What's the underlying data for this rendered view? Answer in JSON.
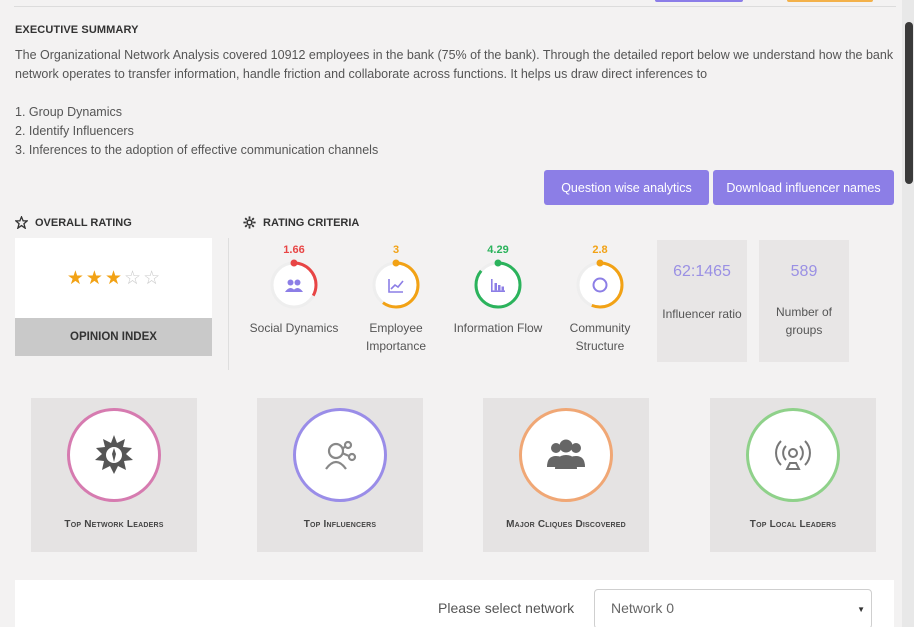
{
  "executive_summary": {
    "title": "EXECUTIVE SUMMARY",
    "text": "The Organizational Network Analysis covered 10912 employees in the bank (75% of the bank). Through the detailed report below we understand how the bank network operates to transfer information, handle friction and collaborate across functions. It helps us draw direct inferences to",
    "items": [
      "1. Group Dynamics",
      "2. Identify Influencers",
      "3. Inferences to the adoption of effective communication channels"
    ]
  },
  "actions": {
    "question_wise": "Question wise analytics",
    "download_influencers": "Download influencer names"
  },
  "overall_rating": {
    "title": "OVERALL RATING",
    "stars_filled": 3,
    "stars_total": 5,
    "opinion_index_label": "OPINION INDEX"
  },
  "rating_criteria": {
    "title": "RATING CRITERIA",
    "items": [
      {
        "value": "1.66",
        "label_line1": "Social Dynamics",
        "label_line2": "",
        "color": "#e84545",
        "fraction": 0.33,
        "icon": "people-icon"
      },
      {
        "value": "3",
        "label_line1": "Employee",
        "label_line2": "Importance",
        "color": "#f2a215",
        "fraction": 0.6,
        "icon": "chart-icon"
      },
      {
        "value": "4.29",
        "label_line1": "Information Flow",
        "label_line2": "",
        "color": "#2bb35c",
        "fraction": 0.86,
        "icon": "bar-chart-icon"
      },
      {
        "value": "2.8",
        "label_line1": "Community",
        "label_line2": "Structure",
        "color": "#f2a215",
        "fraction": 0.56,
        "icon": "ring-icon"
      }
    ],
    "stats": [
      {
        "value": "62:1465",
        "label_line1": "Influencer ratio",
        "label_line2": ""
      },
      {
        "value": "589",
        "label_line1": "Number of",
        "label_line2": "groups"
      }
    ]
  },
  "cards": [
    {
      "label": "Top Network Leaders",
      "color": "#d67bb0",
      "icon": "badge-icon"
    },
    {
      "label": "Top Influencers",
      "color": "#9a8de8",
      "icon": "influencer-icon"
    },
    {
      "label": "Major Cliques Discovered",
      "color": "#f0a775",
      "icon": "group-icon"
    },
    {
      "label": "Top Local Leaders",
      "color": "#8fd18a",
      "icon": "broadcast-icon"
    }
  ],
  "network_select": {
    "label": "Please select network",
    "value": "Network 0"
  },
  "colors": {
    "accent": "#8c7ee6",
    "star": "#f2a215"
  }
}
